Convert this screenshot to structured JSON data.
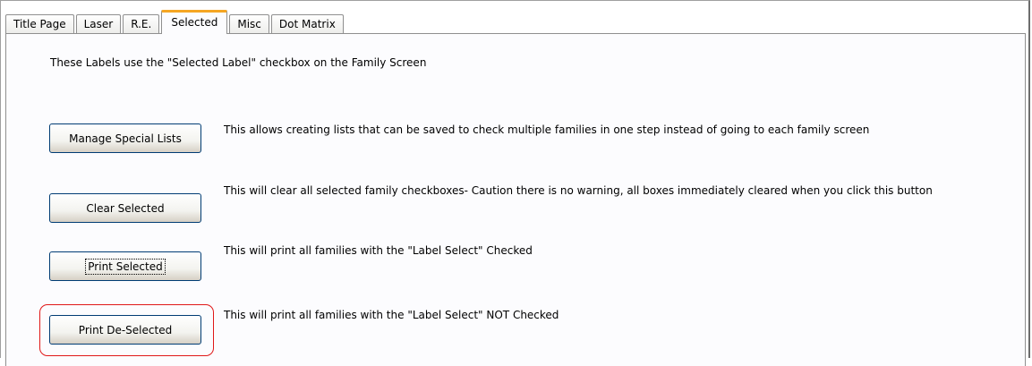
{
  "tabs": [
    {
      "label": "Title Page",
      "active": false
    },
    {
      "label": "Laser",
      "active": false
    },
    {
      "label": "R.E.",
      "active": false
    },
    {
      "label": "Selected",
      "active": true
    },
    {
      "label": "Misc",
      "active": false
    },
    {
      "label": "Dot Matrix",
      "active": false
    }
  ],
  "intro_text": "These Labels use the \"Selected Label\" checkbox on the Family Screen",
  "actions": [
    {
      "button_label": "Manage Special Lists",
      "description": "This allows creating lists that can be saved to check multiple families in one step instead of going to each family screen"
    },
    {
      "button_label": "Clear Selected",
      "description": "This will clear all selected family checkboxes- Caution there is no warning, all boxes immediately cleared when you click this button"
    },
    {
      "button_label": "Print Selected",
      "description": "This will print all families with the \"Label Select\" Checked"
    },
    {
      "button_label": "Print De-Selected",
      "description": "This will print all families with the \"Label Select\" NOT Checked"
    }
  ],
  "colors": {
    "active_tab_accent": "#f5a623",
    "button_border": "#003c74",
    "highlight_ring": "#e01818"
  }
}
